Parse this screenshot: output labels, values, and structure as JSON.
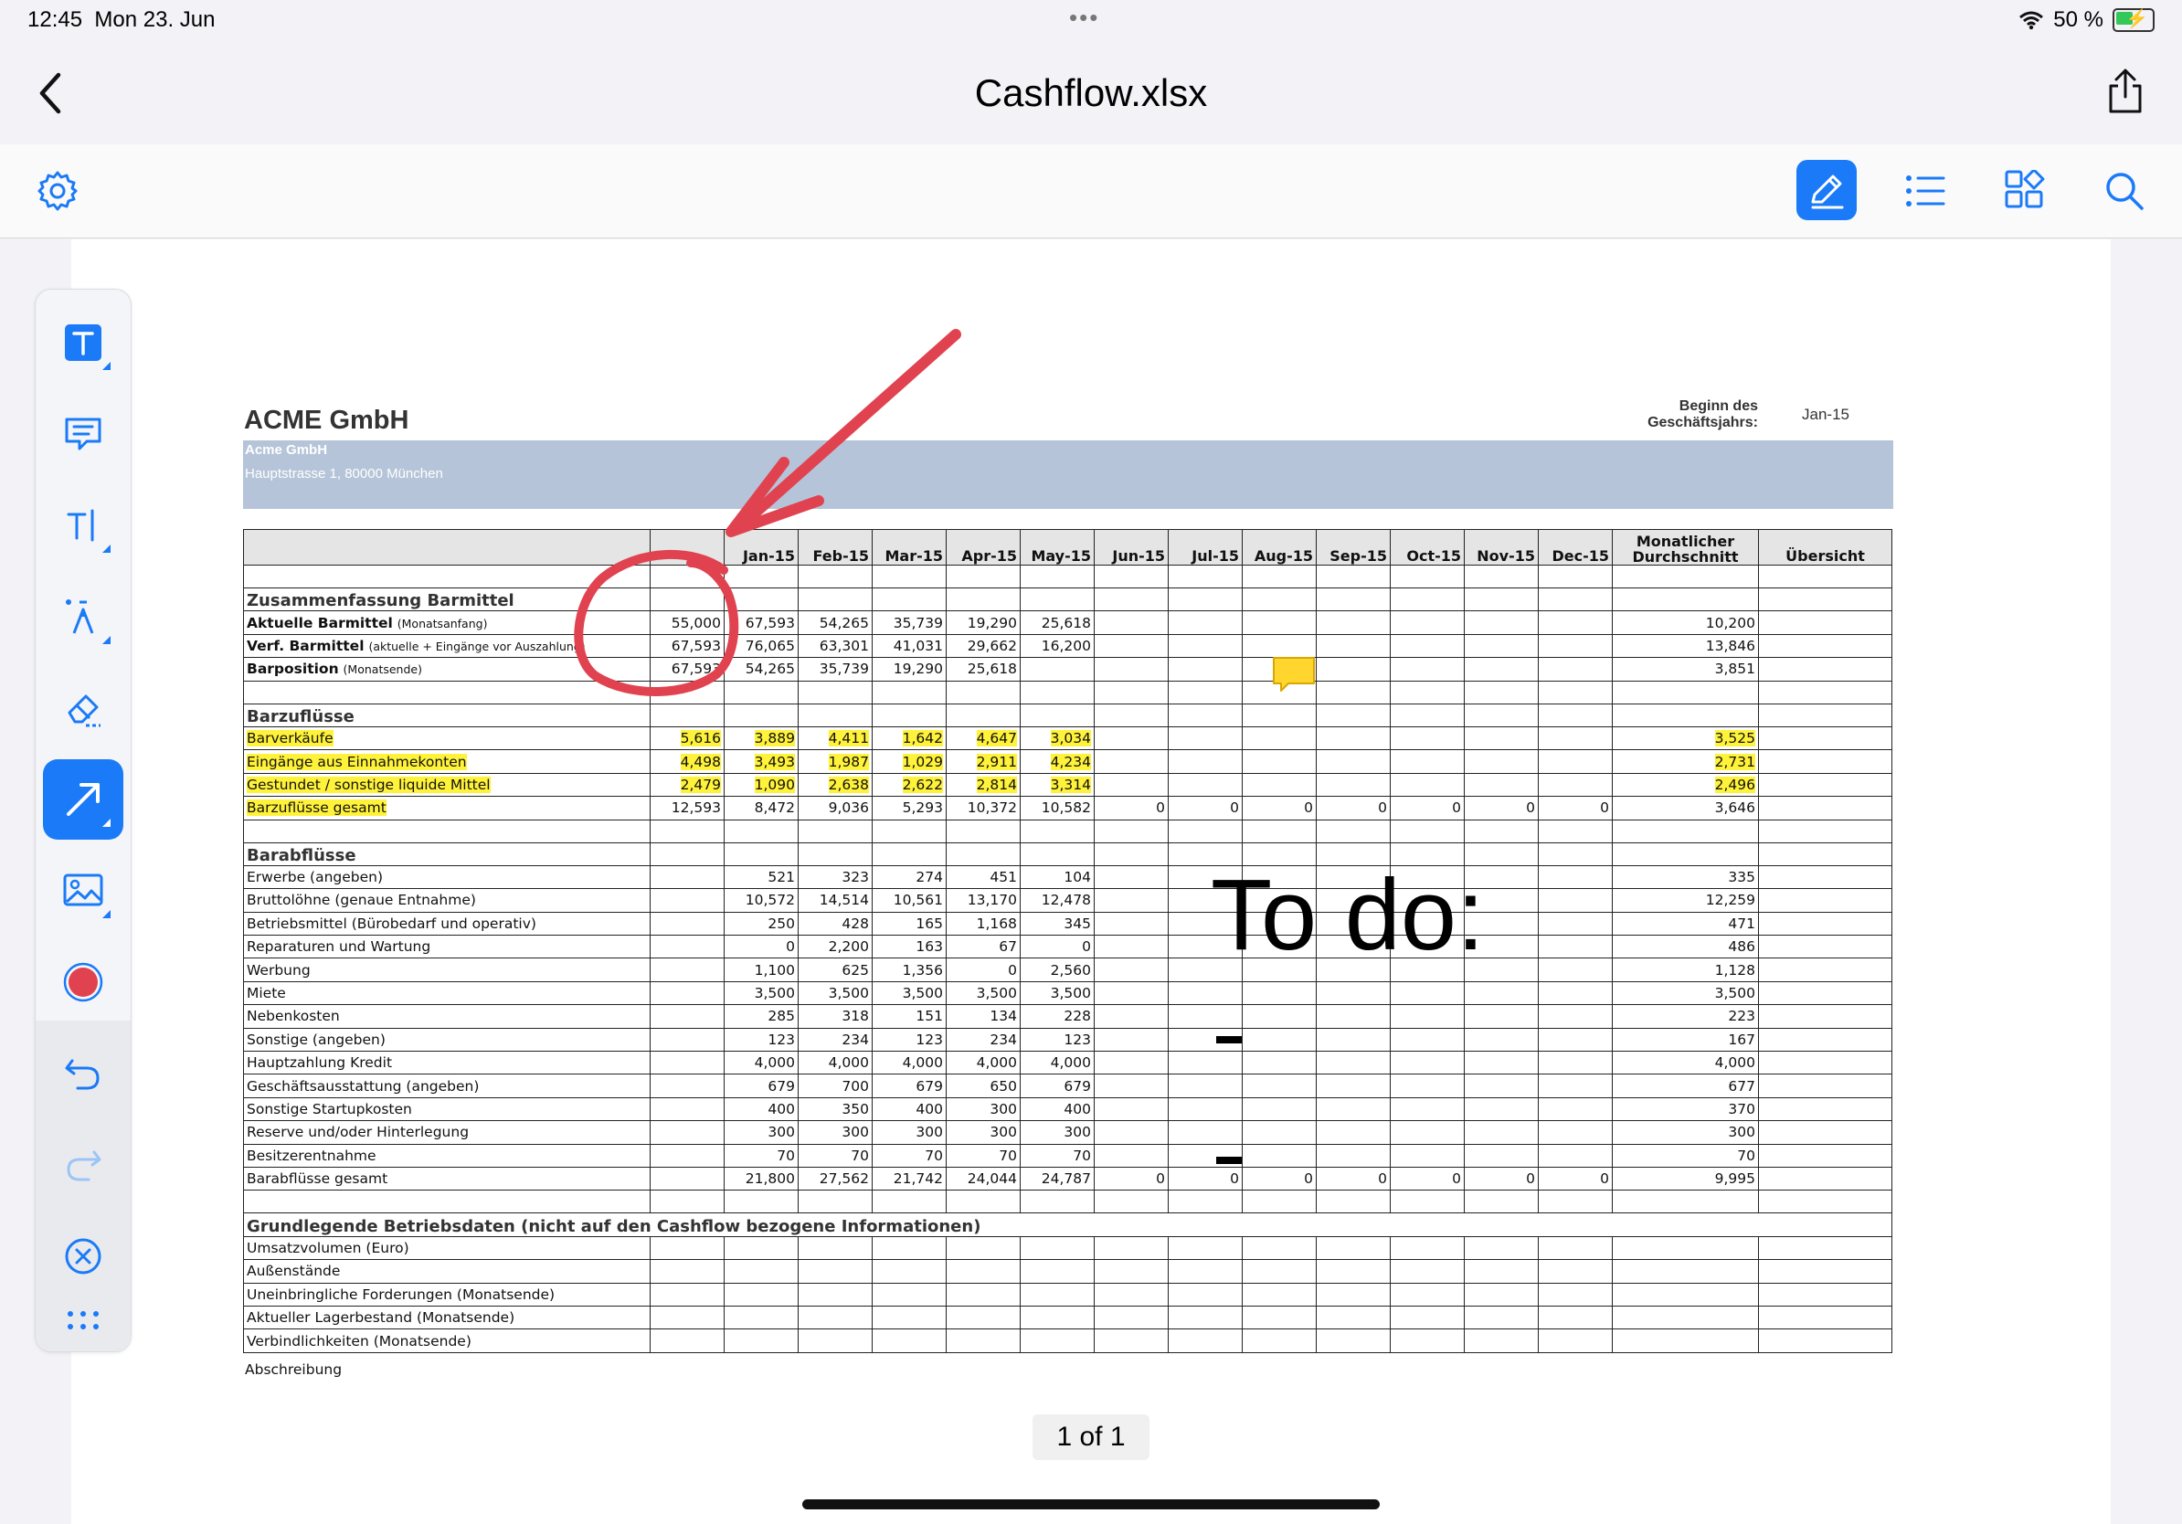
{
  "status": {
    "time": "12:45",
    "date": "Mon 23. Jun",
    "battery": "50 %"
  },
  "title": "Cashflow.xlsx",
  "pager": "1 of 1",
  "sheet": {
    "company": "ACME GmbH",
    "band_name": "Acme GmbH",
    "band_address": "Hauptstrasse 1, 80000 München",
    "beginn_label_1": "Beginn des",
    "beginn_label_2": "Geschäftsjahrs:",
    "beginn_value": "Jan-15",
    "months": [
      "",
      "Jan-15",
      "Feb-15",
      "Mar-15",
      "Apr-15",
      "May-15",
      "Jun-15",
      "Jul-15",
      "Aug-15",
      "Sep-15",
      "Oct-15",
      "Nov-15",
      "Dec-15"
    ],
    "avg_header_1": "Monatlicher",
    "avg_header_2": "Durchschnitt",
    "overview_header": "Übersicht",
    "sections": [
      {
        "title": "Zusammenfassung Barmittel",
        "rows": [
          {
            "label": "Aktuelle Barmittel",
            "sub": "(Monatsanfang)",
            "bold": true,
            "values": [
              "55,000",
              "67,593",
              "54,265",
              "35,739",
              "19,290",
              "25,618",
              "",
              "",
              "",
              "",
              "",
              "",
              ""
            ],
            "avg": "10,200"
          },
          {
            "label": "Verf. Barmittel",
            "sub": "(aktuelle + Eingänge vor Auszahlung)",
            "bold": true,
            "values": [
              "67,593",
              "76,065",
              "63,301",
              "41,031",
              "29,662",
              "16,200",
              "",
              "",
              "",
              "",
              "",
              "",
              ""
            ],
            "avg": "13,846"
          },
          {
            "label": "Barposition",
            "sub": "(Monatsende)",
            "bold": true,
            "values": [
              "67,593",
              "54,265",
              "35,739",
              "19,290",
              "25,618",
              "",
              "",
              "",
              "",
              "",
              "",
              "",
              ""
            ],
            "avg": "3,851"
          }
        ]
      },
      {
        "title": "Barzuflüsse",
        "rows": [
          {
            "label": "Barverkäufe",
            "highlight": true,
            "values": [
              "5,616",
              "3,889",
              "4,411",
              "1,642",
              "4,647",
              "3,034",
              "",
              "",
              "",
              "",
              "",
              "",
              ""
            ],
            "avg": "3,525"
          },
          {
            "label": "Eingänge aus Einnahmekonten",
            "highlight": true,
            "values": [
              "4,498",
              "3,493",
              "1,987",
              "1,029",
              "2,911",
              "4,234",
              "",
              "",
              "",
              "",
              "",
              "",
              ""
            ],
            "avg": "2,731"
          },
          {
            "label": "Gestundet / sonstige liquide Mittel",
            "highlight": true,
            "values": [
              "2,479",
              "1,090",
              "2,638",
              "2,622",
              "2,814",
              "3,314",
              "",
              "",
              "",
              "",
              "",
              "",
              ""
            ],
            "avg": "2,496"
          },
          {
            "label": "Barzuflüsse gesamt",
            "highlight_label": true,
            "values": [
              "12,593",
              "8,472",
              "9,036",
              "5,293",
              "10,372",
              "10,582",
              "0",
              "0",
              "0",
              "0",
              "0",
              "0",
              "0"
            ],
            "avg": "3,646"
          }
        ]
      },
      {
        "title": "Barabflüsse",
        "rows": [
          {
            "label": "Erwerbe (angeben)",
            "values": [
              "",
              "521",
              "323",
              "274",
              "451",
              "104",
              "",
              "",
              "",
              "",
              "",
              "",
              ""
            ],
            "avg": "335"
          },
          {
            "label": "Bruttolöhne (genaue Entnahme)",
            "values": [
              "",
              "10,572",
              "14,514",
              "10,561",
              "13,170",
              "12,478",
              "",
              "",
              "",
              "",
              "",
              "",
              ""
            ],
            "avg": "12,259"
          },
          {
            "label": "Betriebsmittel (Bürobedarf und operativ)",
            "values": [
              "",
              "250",
              "428",
              "165",
              "1,168",
              "345",
              "",
              "",
              "",
              "",
              "",
              "",
              ""
            ],
            "avg": "471"
          },
          {
            "label": "Reparaturen und Wartung",
            "values": [
              "",
              "0",
              "2,200",
              "163",
              "67",
              "0",
              "",
              "",
              "",
              "",
              "",
              "",
              ""
            ],
            "avg": "486"
          },
          {
            "label": "Werbung",
            "values": [
              "",
              "1,100",
              "625",
              "1,356",
              "0",
              "2,560",
              "",
              "",
              "",
              "",
              "",
              "",
              ""
            ],
            "avg": "1,128"
          },
          {
            "label": "Miete",
            "values": [
              "",
              "3,500",
              "3,500",
              "3,500",
              "3,500",
              "3,500",
              "",
              "",
              "",
              "",
              "",
              "",
              ""
            ],
            "avg": "3,500"
          },
          {
            "label": "Nebenkosten",
            "values": [
              "",
              "285",
              "318",
              "151",
              "134",
              "228",
              "",
              "",
              "",
              "",
              "",
              "",
              ""
            ],
            "avg": "223"
          },
          {
            "label": "Sonstige (angeben)",
            "values": [
              "",
              "123",
              "234",
              "123",
              "234",
              "123",
              "",
              "",
              "",
              "",
              "",
              "",
              ""
            ],
            "avg": "167"
          },
          {
            "label": "Hauptzahlung Kredit",
            "values": [
              "",
              "4,000",
              "4,000",
              "4,000",
              "4,000",
              "4,000",
              "",
              "",
              "",
              "",
              "",
              "",
              ""
            ],
            "avg": "4,000"
          },
          {
            "label": "Geschäftsausstattung (angeben)",
            "values": [
              "",
              "679",
              "700",
              "679",
              "650",
              "679",
              "",
              "",
              "",
              "",
              "",
              "",
              ""
            ],
            "avg": "677"
          },
          {
            "label": "Sonstige Startupkosten",
            "values": [
              "",
              "400",
              "350",
              "400",
              "300",
              "400",
              "",
              "",
              "",
              "",
              "",
              "",
              ""
            ],
            "avg": "370"
          },
          {
            "label": "Reserve und/oder Hinterlegung",
            "values": [
              "",
              "300",
              "300",
              "300",
              "300",
              "300",
              "",
              "",
              "",
              "",
              "",
              "",
              ""
            ],
            "avg": "300"
          },
          {
            "label": "Besitzerentnahme",
            "values": [
              "",
              "70",
              "70",
              "70",
              "70",
              "70",
              "",
              "",
              "",
              "",
              "",
              "",
              ""
            ],
            "avg": "70"
          },
          {
            "label": "Barabflüsse gesamt",
            "values": [
              "",
              "21,800",
              "27,562",
              "21,742",
              "24,044",
              "24,787",
              "0",
              "0",
              "0",
              "0",
              "0",
              "0",
              "0"
            ],
            "avg": "9,995"
          }
        ]
      },
      {
        "title": "Grundlegende Betriebsdaten (nicht auf den Cashflow bezogene Informationen)",
        "rows": [
          {
            "label": "Umsatzvolumen (Euro)",
            "values": [
              "",
              "",
              "",
              "",
              "",
              "",
              "",
              "",
              "",
              "",
              "",
              "",
              ""
            ],
            "avg": ""
          },
          {
            "label": "Außenstände",
            "values": [
              "",
              "",
              "",
              "",
              "",
              "",
              "",
              "",
              "",
              "",
              "",
              "",
              ""
            ],
            "avg": ""
          },
          {
            "label": "Uneinbringliche Forderungen (Monatsende)",
            "values": [
              "",
              "",
              "",
              "",
              "",
              "",
              "",
              "",
              "",
              "",
              "",
              "",
              ""
            ],
            "avg": ""
          },
          {
            "label": "Aktueller Lagerbestand (Monatsende)",
            "values": [
              "",
              "",
              "",
              "",
              "",
              "",
              "",
              "",
              "",
              "",
              "",
              "",
              ""
            ],
            "avg": ""
          },
          {
            "label": "Verbindlichkeiten (Monatsende)",
            "values": [
              "",
              "",
              "",
              "",
              "",
              "",
              "",
              "",
              "",
              "",
              "",
              "",
              ""
            ],
            "avg": ""
          }
        ]
      }
    ],
    "trailing_label": "Abschreibung"
  },
  "annotations": {
    "todo_text": "To do:",
    "ink_color": "#e0434f",
    "note_color": "#ffd52e"
  },
  "colors": {
    "accent": "#1a7af8",
    "highlight": "#fff23a",
    "band": "#b5c4d8"
  },
  "icons": {
    "toolbar": [
      "settings-icon",
      "pencil-icon",
      "list-icon",
      "grid-icon",
      "search-icon"
    ],
    "tools": [
      "text-box-icon",
      "comment-icon",
      "text-cursor-icon",
      "pen-icon",
      "eraser-icon",
      "arrow-icon",
      "image-icon",
      "color-icon",
      "undo-icon",
      "redo-icon",
      "close-icon",
      "more-icon"
    ]
  }
}
